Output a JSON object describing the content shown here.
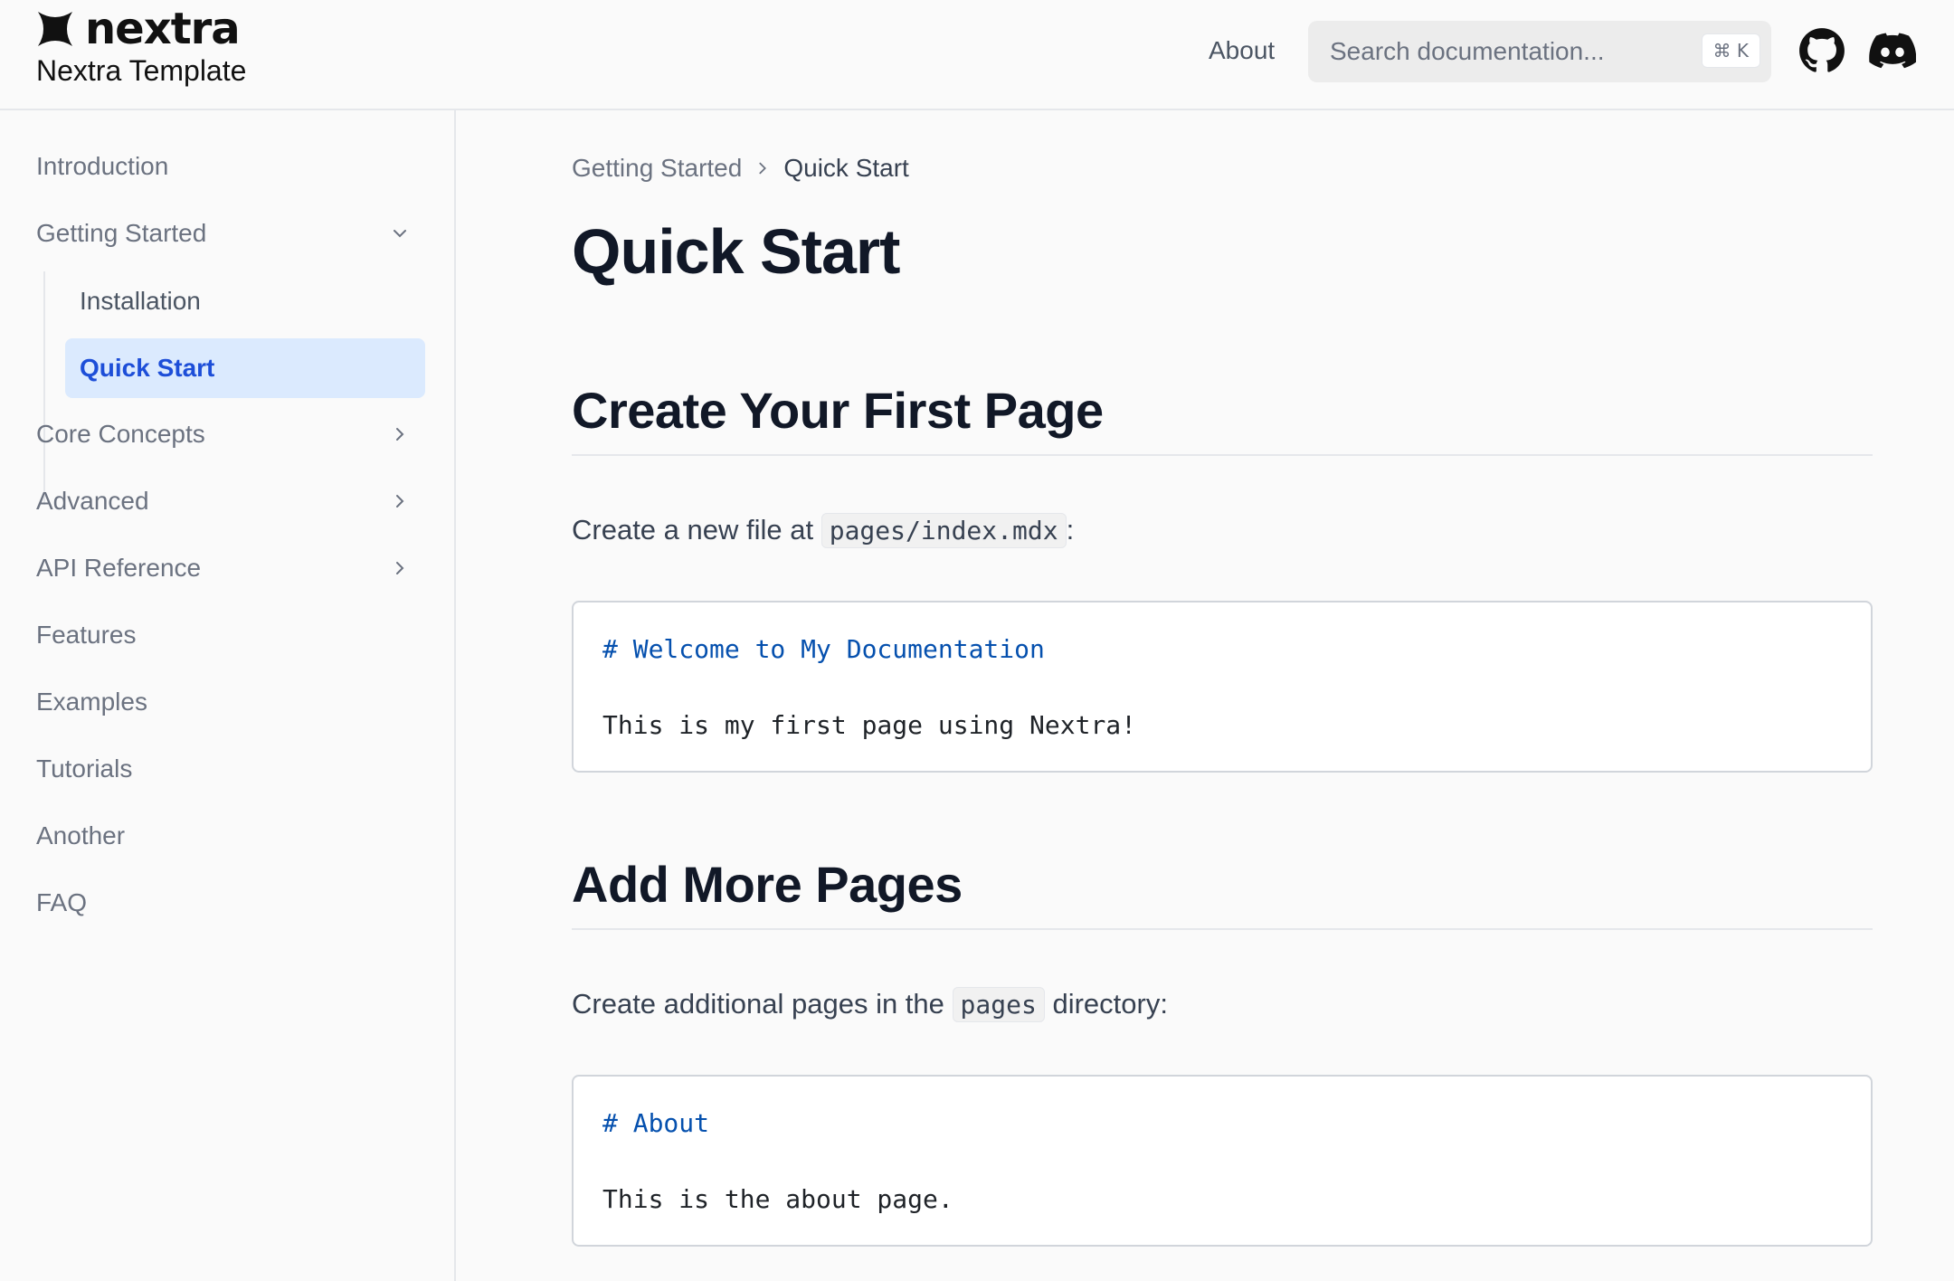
{
  "navbar": {
    "logo_text": "nextra",
    "site_title": "Nextra Template",
    "about_link": "About",
    "search_placeholder": "Search documentation...",
    "search_shortcut": "⌘ K",
    "icons": [
      "github-icon",
      "discord-icon"
    ]
  },
  "sidebar": {
    "items": [
      {
        "label": "Introduction"
      },
      {
        "label": "Getting Started",
        "expanded": true,
        "children": [
          {
            "label": "Installation"
          },
          {
            "label": "Quick Start",
            "active": true
          }
        ]
      },
      {
        "label": "Core Concepts",
        "collapsible": true
      },
      {
        "label": "Advanced",
        "collapsible": true
      },
      {
        "label": "API Reference",
        "collapsible": true
      },
      {
        "label": "Features"
      },
      {
        "label": "Examples"
      },
      {
        "label": "Tutorials"
      },
      {
        "label": "Another"
      },
      {
        "label": "FAQ"
      }
    ]
  },
  "main": {
    "breadcrumb": {
      "parent": "Getting Started",
      "current": "Quick Start"
    },
    "title": "Quick Start",
    "sections": [
      {
        "heading": "Create Your First Page",
        "text_before": "Create a new file at",
        "inline_code": "pages/index.mdx",
        "text_after": ":",
        "code": {
          "heading_line": "# Welcome to My Documentation",
          "body_line": "This is my first page using Nextra!"
        }
      },
      {
        "heading": "Add More Pages",
        "text_before": "Create additional pages in the",
        "inline_code": "pages",
        "text_after": "directory:",
        "code": {
          "heading_line": "# About",
          "body_line": "This is the about page."
        }
      }
    ]
  },
  "colors": {
    "accent": "#1d4ed8",
    "active_bg": "#dbeafe",
    "code_heading": "#0550ae",
    "border": "#e5e7eb"
  }
}
